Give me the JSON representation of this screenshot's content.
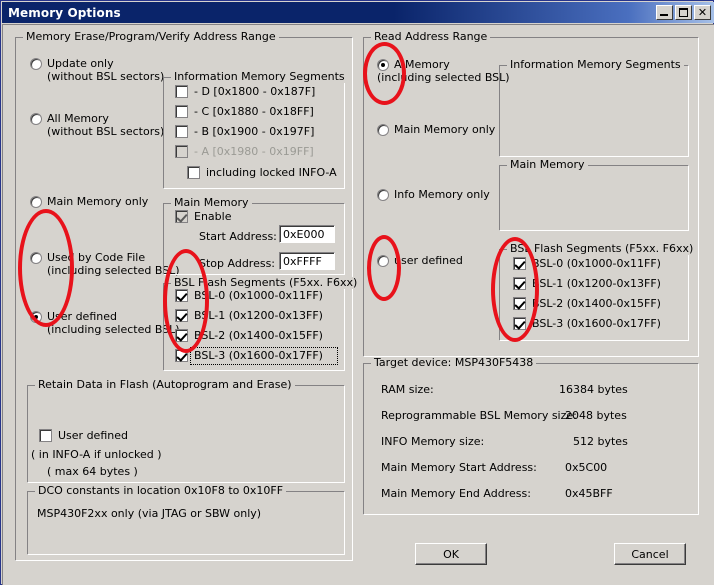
{
  "window": {
    "title": "Memory Options",
    "buttons": {
      "minimize": "minimize-icon",
      "maximize": "maximize-icon",
      "close": "✕"
    }
  },
  "left_panel": {
    "title": "Memory Erase/Program/Verify Address Range",
    "radios": [
      {
        "label": "Update only",
        "sub": "(without BSL sectors)",
        "selected": false
      },
      {
        "label": "All Memory",
        "sub": "(without BSL sectors)",
        "selected": false
      },
      {
        "label": "Main Memory only",
        "sub": "",
        "selected": false
      },
      {
        "label": "Used by Code File",
        "sub": "(including selected BSL)",
        "selected": false
      },
      {
        "label": "User defined",
        "sub": "(including selected BSL)",
        "selected": true
      }
    ],
    "info_segments": {
      "title": "Information Memory Segments",
      "items": [
        {
          "label": "- D  [0x1800 - 0x187F]",
          "checked": false,
          "disabled": false
        },
        {
          "label": "- C  [0x1880 - 0x18FF]",
          "checked": false,
          "disabled": false
        },
        {
          "label": "- B  [0x1900 - 0x197F]",
          "checked": false,
          "disabled": false
        },
        {
          "label": "- A  [0x1980 - 0x19FF]",
          "checked": false,
          "disabled": true
        }
      ],
      "include_locked": {
        "label": "including locked INFO-A",
        "checked": false
      }
    },
    "main_memory": {
      "title": "Main Memory",
      "enable": {
        "label": "Enable",
        "checked": true,
        "disabled": true
      },
      "start_label": "Start Address:",
      "start_value": "0xE000",
      "stop_label": "Stop Address:",
      "stop_value": "0xFFFF"
    },
    "bsl_flash": {
      "title": "BSL Flash Segments (F5xx. F6xx)",
      "items": [
        {
          "label": "BSL-0 (0x1000-0x11FF)",
          "checked": true
        },
        {
          "label": "BSL-1 (0x1200-0x13FF)",
          "checked": true
        },
        {
          "label": "BSL-2 (0x1400-0x15FF)",
          "checked": true
        },
        {
          "label": "BSL-3 (0x1600-0x17FF)",
          "checked": true,
          "focused": true
        }
      ]
    },
    "retain": {
      "title": "Retain Data in Flash (Autoprogram and Erase)",
      "user_defined": {
        "label": "User defined",
        "checked": false
      },
      "note1": "( in INFO-A if unlocked )",
      "note2": "( max 64 bytes )"
    },
    "dco": {
      "title": "DCO constants in location 0x10F8 to 0x10FF",
      "note": "MSP430F2xx only   (via JTAG or SBW only)"
    }
  },
  "right_panel": {
    "title": "Read Address Range",
    "radios": [
      {
        "label": "A  Memory",
        "sub": "(including selected BSL)",
        "selected": true
      },
      {
        "label": "Main Memory only",
        "sub": "",
        "selected": false
      },
      {
        "label": "Info Memory only",
        "sub": "",
        "selected": false
      },
      {
        "label": "user defined",
        "sub": "",
        "selected": false
      }
    ],
    "info_segments": {
      "title": "Information Memory Segments"
    },
    "main_memory": {
      "title": "Main Memory"
    },
    "bsl_flash": {
      "title": "BSL Flash Segments (F5xx. F6xx)",
      "items": [
        {
          "label": "BSL-0 (0x1000-0x11FF)",
          "checked": true
        },
        {
          "label": "BSL-1 (0x1200-0x13FF)",
          "checked": true
        },
        {
          "label": "BSL-2 (0x1400-0x15FF)",
          "checked": true
        },
        {
          "label": "BSL-3 (0x1600-0x17FF)",
          "checked": true
        }
      ]
    },
    "target": {
      "title": "Target device:  MSP430F5438",
      "rows": [
        {
          "label": "RAM size:",
          "value": "16384  bytes"
        },
        {
          "label": "Reprogrammable BSL Memory size:",
          "value": "2048  bytes"
        },
        {
          "label": "INFO Memory size:",
          "value": "512  bytes"
        },
        {
          "label": "Main Memory Start Address:",
          "value": "0x5C00"
        },
        {
          "label": "Main Memory End Address:",
          "value": "0x45BFF"
        }
      ]
    }
  },
  "footer": {
    "ok": "OK",
    "cancel": "Cancel"
  },
  "annotations": {
    "color": "#e8121b",
    "count": 5,
    "targets": [
      "left-radio-group-used-by-code-file-and-user-defined",
      "left-bsl-flash-segment-checkboxes",
      "right-radio-all-memory",
      "right-radio-user-defined",
      "right-bsl-flash-segment-checkboxes"
    ]
  }
}
